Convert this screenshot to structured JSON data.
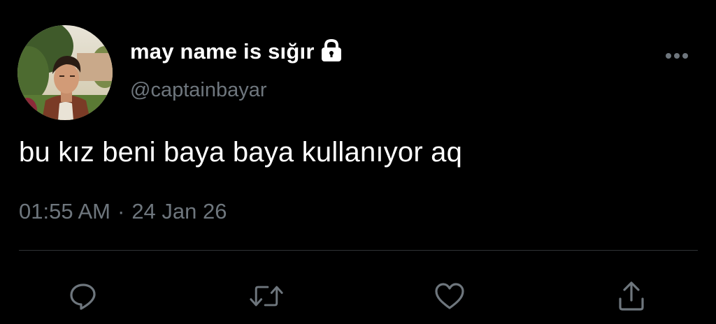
{
  "tweet": {
    "display_name": "may name is sığır",
    "handle": "@captainbayar",
    "text": "bu kız beni baya baya kullanıyor aq",
    "time": "01:55 AM",
    "separator": "·",
    "date": "24 Jan 26",
    "protected": true
  },
  "icons": {
    "lock": "lock-icon",
    "more": "more-horizontal-icon",
    "reply": "reply-icon",
    "retweet": "retweet-icon",
    "like": "like-icon",
    "share": "share-icon"
  },
  "colors": {
    "background": "#000000",
    "text_primary": "#ffffff",
    "text_secondary": "#6e767d",
    "divider": "#2f3336",
    "icon": "#6e767d"
  }
}
